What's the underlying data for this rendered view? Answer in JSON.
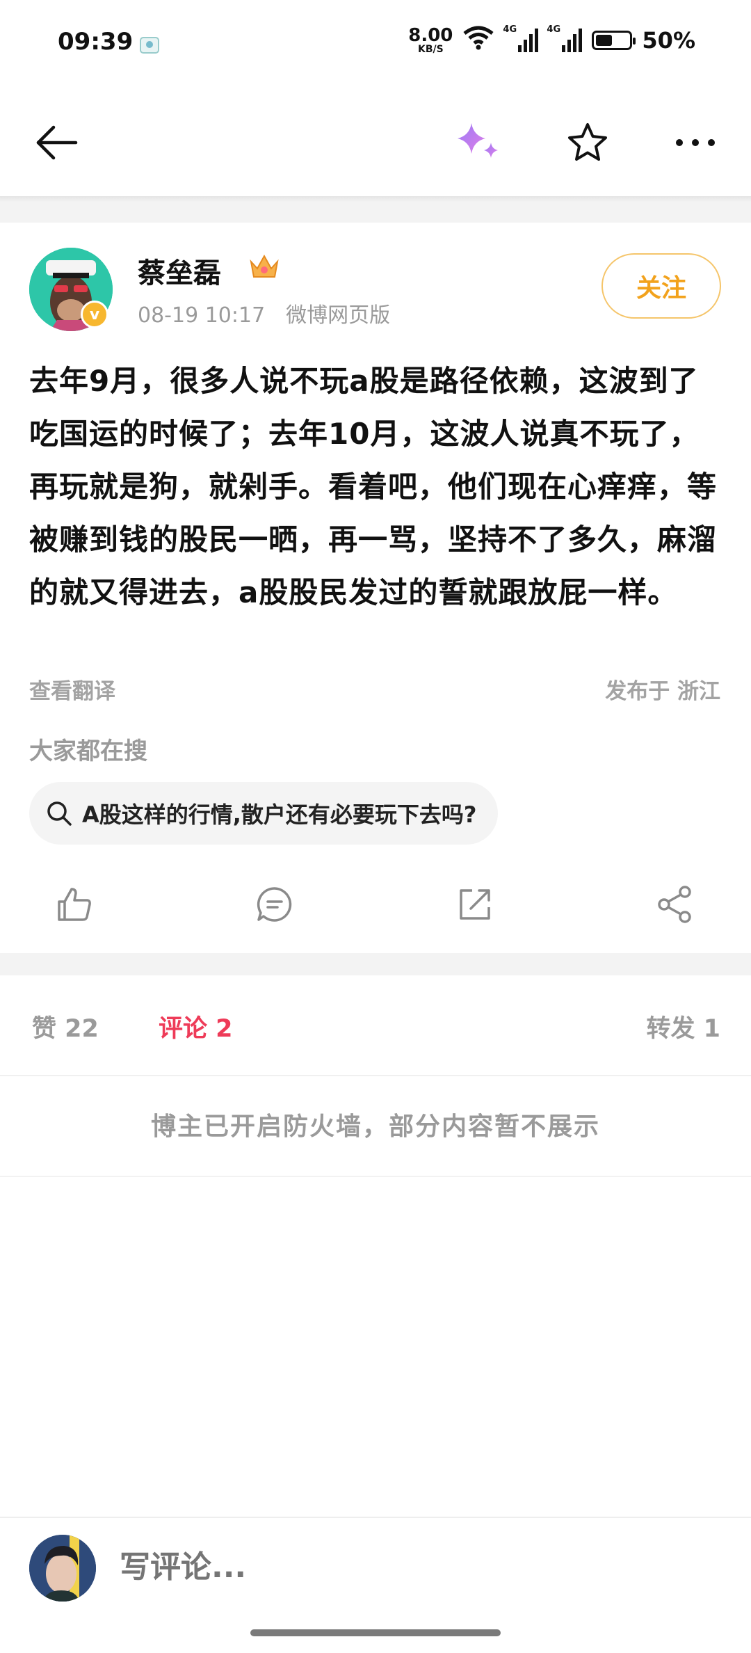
{
  "status_bar": {
    "time": "09:39",
    "net_speed_value": "8.00",
    "net_speed_unit": "KB/S",
    "signal_1_label": "4G",
    "signal_2_label": "4G",
    "battery_percent": "50%",
    "battery_level": 0.5
  },
  "nav": {
    "back_icon": "arrow-left-icon",
    "ai_icon": "sparkle-icon",
    "favorite_icon": "star-icon",
    "more_icon": "more-dots-icon"
  },
  "post": {
    "author": "蔡垒磊",
    "time": "08-19 10:17",
    "source": "微博网页版",
    "follow_label": "关注",
    "text": "去年9月，很多人说不玩a股是路径依赖，这波到了吃国运的时候了；去年10月，这波人说真不玩了，再玩就是狗，就剁手。看着吧，他们现在心痒痒，等被赚到钱的股民一晒，再一骂，坚持不了多久，麻溜的就又得进去，a股股民发过的誓就跟放屁一样。",
    "translate_label": "查看翻译",
    "location_label": "发布于 浙江",
    "search_title": "大家都在搜",
    "search_suggestion": "A股这样的行情,散户还有必要玩下去吗?"
  },
  "actions": {
    "like_icon": "thumb-up-icon",
    "comment_icon": "comment-icon",
    "repost_icon": "repost-icon",
    "share_icon": "share-icon"
  },
  "tabs": {
    "like": "赞 22",
    "comment": "评论 2",
    "repost": "转发 1"
  },
  "firewall_notice": "博主已开启防火墙，部分内容暂不展示",
  "comment_bar": {
    "placeholder": "写评论..."
  },
  "colors": {
    "accent_red": "#ee3b58",
    "follow_orange": "#f2a21c",
    "muted_gray": "#9a9a9a"
  }
}
